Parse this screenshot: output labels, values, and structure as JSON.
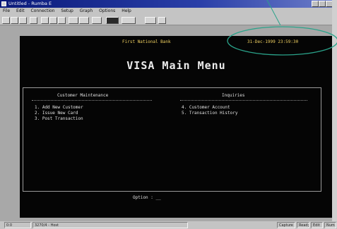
{
  "window": {
    "title": "Untitled - Rumba E",
    "controls": [
      "minimize",
      "maximize",
      "close"
    ]
  },
  "menu": {
    "items": [
      "File",
      "Edit",
      "Connection",
      "Setup",
      "Graph",
      "Options",
      "Help"
    ]
  },
  "toolbar": {
    "buttons": [
      "new-icon",
      "open-icon",
      "save-icon",
      "print-icon",
      "cut-icon",
      "copy-icon",
      "paste-icon",
      "connect-icon",
      "disconnect-icon",
      "transfer-icon",
      "record-icon",
      "play-icon",
      "display-icon",
      "help-icon"
    ]
  },
  "terminal": {
    "bank": "First National Bank",
    "datetime": "31-Dec-1999 23:59:30",
    "title": "VISA Main Menu",
    "sections": {
      "maintenance": {
        "heading": "Customer Maintenance",
        "items": [
          "1. Add New Customer",
          "2. Issue New Card",
          "3. Post Transaction"
        ]
      },
      "inquiries": {
        "heading": "Inquiries",
        "items": [
          "4. Customer Account",
          "5. Transaction History"
        ]
      }
    },
    "prompt": "Option : __"
  },
  "statusbar": {
    "cell1": "0:0",
    "cell2": "3270/4 - Host",
    "right": [
      "Capture",
      "Ready",
      "Edit",
      "Num"
    ]
  },
  "colors": {
    "terminal_bg": "#050505",
    "header_text": "#f0d060",
    "annotation": "#2aa38a"
  }
}
